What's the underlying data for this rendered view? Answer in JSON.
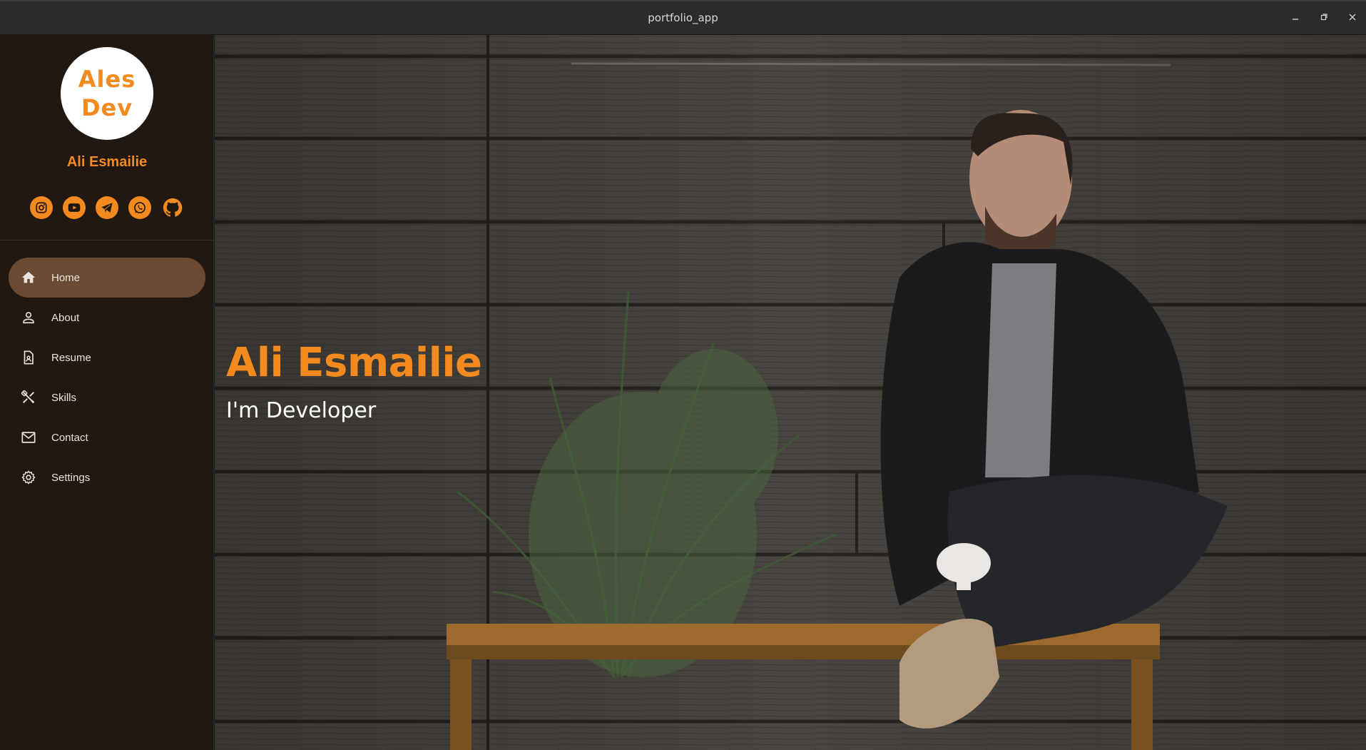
{
  "window": {
    "title": "portfolio_app",
    "controls": {
      "minimize": "–",
      "restore": "▫",
      "close": "✕"
    }
  },
  "sidebar": {
    "logo": {
      "line1": "Ales",
      "line2": "Dev"
    },
    "profile_name": "Ali Esmailie",
    "social": [
      {
        "icon": "instagram-icon"
      },
      {
        "icon": "youtube-icon"
      },
      {
        "icon": "telegram-icon"
      },
      {
        "icon": "whatsapp-icon"
      },
      {
        "icon": "github-icon"
      }
    ],
    "nav": [
      {
        "label": "Home",
        "icon": "home-icon",
        "active": true
      },
      {
        "label": "About",
        "icon": "person-icon",
        "active": false
      },
      {
        "label": "Resume",
        "icon": "resume-icon",
        "active": false
      },
      {
        "label": "Skills",
        "icon": "skills-icon",
        "active": false
      },
      {
        "label": "Contact",
        "icon": "mail-icon",
        "active": false
      },
      {
        "label": "Settings",
        "icon": "gear-icon",
        "active": false
      }
    ]
  },
  "hero": {
    "name": "Ali Esmailie",
    "subtitle": "I'm Developer"
  },
  "colors": {
    "accent": "#f28a1f",
    "sidebar_bg": "#221812",
    "nav_active_bg": "#6b4a33",
    "titlebar_bg": "#2b2b2b"
  }
}
